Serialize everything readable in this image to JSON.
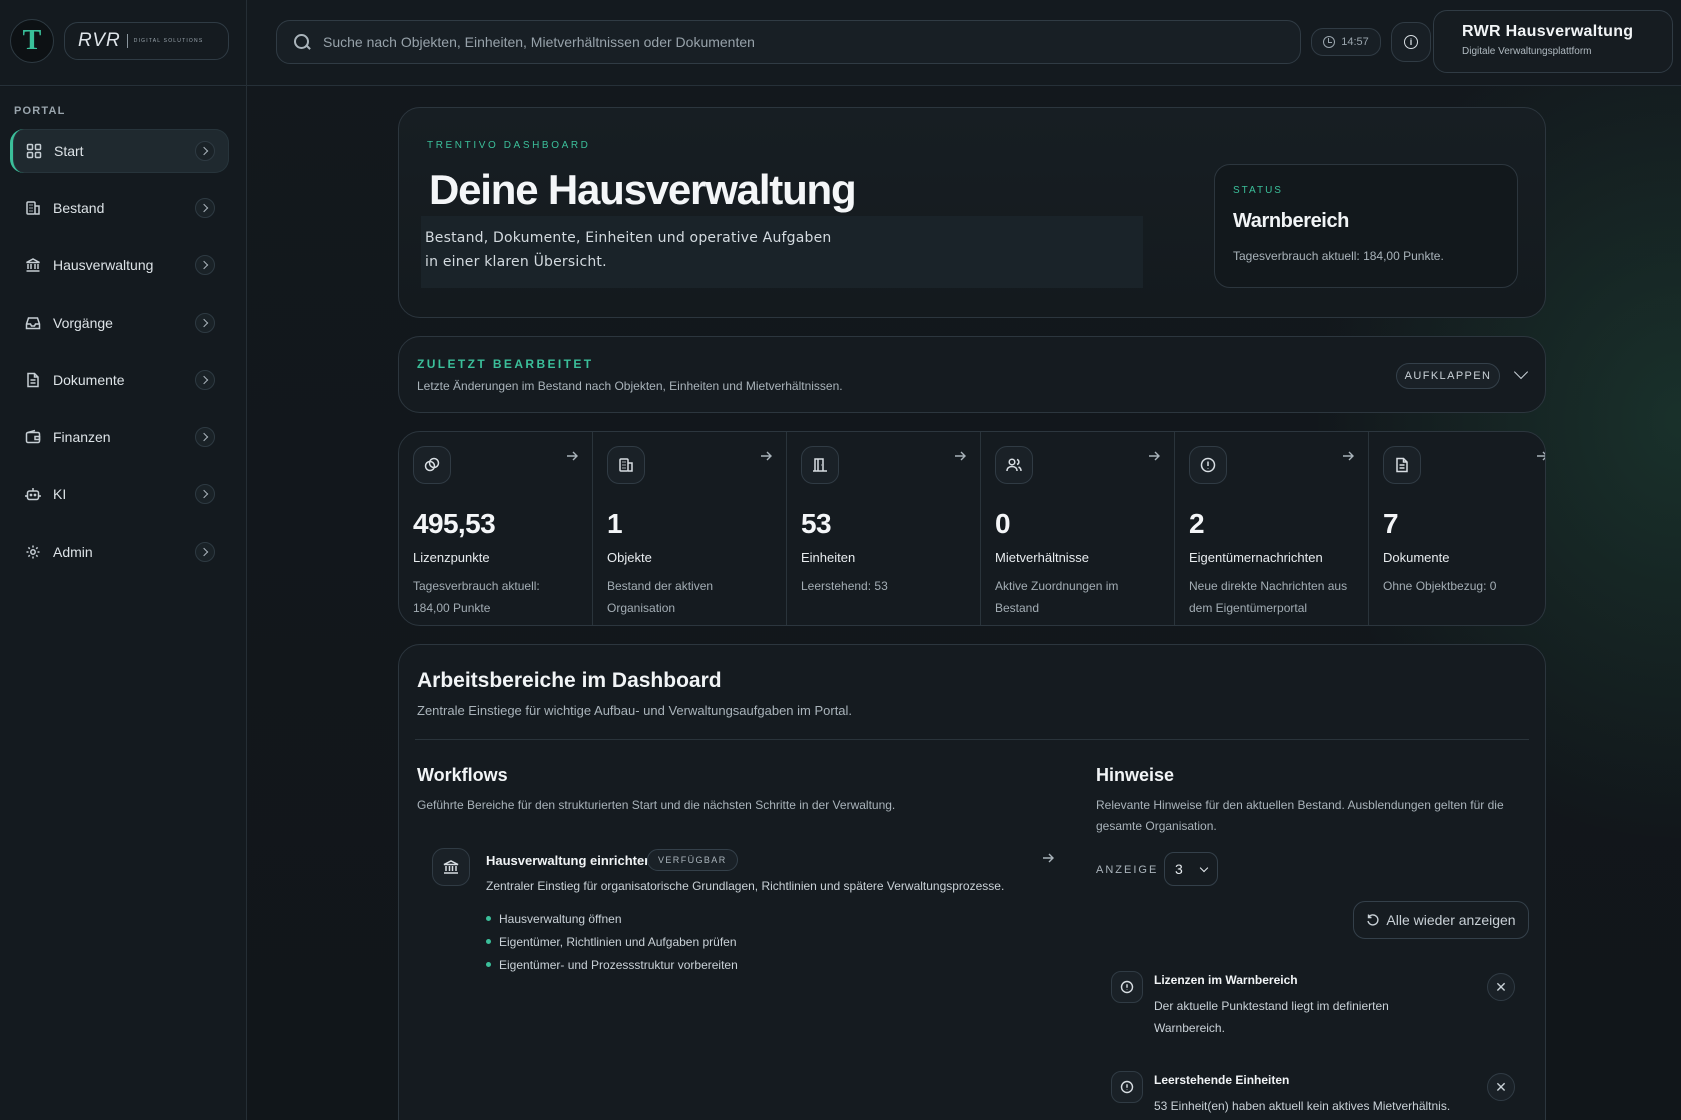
{
  "header": {
    "logo_letter": "T",
    "brand_mark": "RVR",
    "brand_sub": "DIGITAL SOLUTIONS",
    "search_placeholder": "Suche nach Objekten, Einheiten, Mietverhältnissen oder Dokumenten",
    "time": "14:57",
    "org_name": "RWR Hausverwaltung",
    "org_sub": "Digitale Verwaltungsplattform"
  },
  "sidebar": {
    "section_label": "PORTAL",
    "items": [
      {
        "label": "Start",
        "icon": "grid-icon",
        "active": true
      },
      {
        "label": "Bestand",
        "icon": "building-icon"
      },
      {
        "label": "Hausverwaltung",
        "icon": "bank-icon"
      },
      {
        "label": "Vorgänge",
        "icon": "inbox-icon"
      },
      {
        "label": "Dokumente",
        "icon": "document-icon"
      },
      {
        "label": "Finanzen",
        "icon": "wallet-icon"
      },
      {
        "label": "KI",
        "icon": "bot-icon"
      },
      {
        "label": "Admin",
        "icon": "gear-icon"
      }
    ]
  },
  "hero": {
    "kicker": "TRENTIVO DASHBOARD",
    "title": "Deine Hausverwaltung",
    "desc": "Bestand, Dokumente, Einheiten und operative Aufgaben in einer klaren Übersicht.",
    "status_label": "STATUS",
    "status_value": "Warnbereich",
    "status_note": "Tagesverbrauch aktuell: 184,00 Punkte."
  },
  "recent": {
    "kicker": "ZULETZT BEARBEITET",
    "desc": "Letzte Änderungen im Bestand nach Objekten, Einheiten und Mietverhältnissen.",
    "expand_label": "AUFKLAPPEN"
  },
  "stats": [
    {
      "value": "495,53",
      "label": "Lizenzpunkte",
      "note": "Tagesverbrauch aktuell: 184,00 Punkte",
      "icon": "coins-icon"
    },
    {
      "value": "1",
      "label": "Objekte",
      "note": "Bestand der aktiven Organisation",
      "icon": "building-icon"
    },
    {
      "value": "53",
      "label": "Einheiten",
      "note": "Leerstehend: 53",
      "icon": "door-icon"
    },
    {
      "value": "0",
      "label": "Mietverhältnisse",
      "note": "Aktive Zuordnungen im Bestand",
      "icon": "users-icon"
    },
    {
      "value": "2",
      "label": "Eigentümernachrichten",
      "note": "Neue direkte Nachrichten aus dem Eigentümerportal",
      "icon": "alert-icon"
    },
    {
      "value": "7",
      "label": "Dokumente",
      "note": "Ohne Objektbezug: 0",
      "icon": "document-icon"
    }
  ],
  "work": {
    "title": "Arbeitsbereiche im Dashboard",
    "desc": "Zentrale Einstiege für wichtige Aufbau- und Verwaltungsaufgaben im Portal.",
    "workflows": {
      "title": "Workflows",
      "desc": "Geführte Bereiche für den strukturierten Start und die nächsten Schritte in der Verwaltung.",
      "item": {
        "title": "Hausverwaltung einrichten",
        "badge": "VERFÜGBAR",
        "desc": "Zentraler Einstieg für organisatorische Grundlagen, Richtlinien und spätere Verwaltungsprozesse.",
        "steps": [
          "Hausverwaltung öffnen",
          "Eigentümer, Richtlinien und Aufgaben prüfen",
          "Eigentümer- und Prozessstruktur vorbereiten"
        ]
      }
    },
    "hints": {
      "title": "Hinweise",
      "desc": "Relevante Hinweise für den aktuellen Bestand. Ausblendungen gelten für die gesamte Organisation.",
      "display_label": "ANZEIGE",
      "display_value": "3",
      "reset_label": "Alle wieder anzeigen",
      "items": [
        {
          "title": "Lizenzen im Warnbereich",
          "desc": "Der aktuelle Punktestand liegt im definierten Warnbereich."
        },
        {
          "title": "Leerstehende Einheiten",
          "desc": "53 Einheit(en) haben aktuell kein aktives Mietverhältnis."
        }
      ]
    }
  },
  "colors": {
    "accent": "#3bbf9a",
    "background": "#12161b",
    "card": "#151b20",
    "border": "#2c363e"
  }
}
